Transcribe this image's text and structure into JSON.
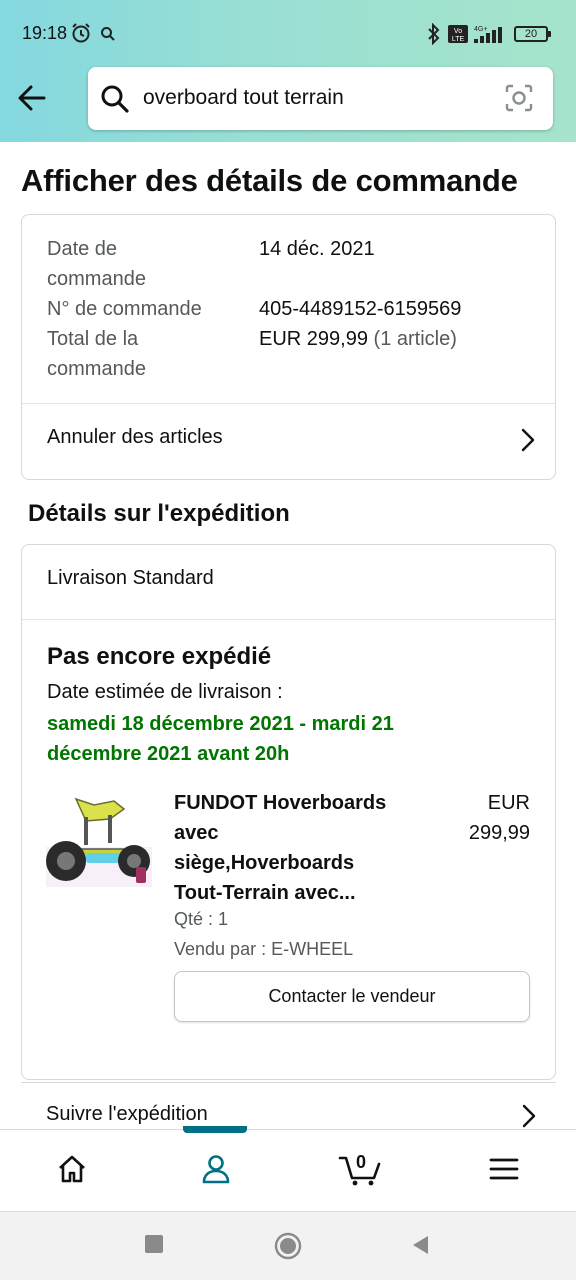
{
  "status_bar": {
    "time": "19:18",
    "battery": "20",
    "icons": [
      "alarm-icon",
      "search-small-icon",
      "bluetooth-icon",
      "volte-icon",
      "4g-signal-icon"
    ]
  },
  "search": {
    "value": "overboard tout terrain",
    "icons": [
      "back-arrow-icon",
      "search-icon",
      "camera-scan-icon"
    ]
  },
  "page": {
    "title": "Afficher des détails de commande"
  },
  "order_summary": {
    "date_label_line1": "Date de",
    "date_label_line2": "commande",
    "date_value": "14 déc. 2021",
    "number_label": "N° de commande",
    "number_value": "405-4489152-6159569",
    "total_label_line1": "Total de la",
    "total_label_line2": "commande",
    "total_value": "EUR 299,99",
    "total_count": "(1 article)",
    "cancel_label": "Annuler des articles"
  },
  "shipping": {
    "section_title": "Détails sur l'expédition",
    "method": "Livraison Standard",
    "status": "Pas encore expédié",
    "estimate_label": "Date estimée de livraison :",
    "estimate_date": "samedi 18 décembre 2021 - mardi 21 décembre 2021 avant 20h",
    "item": {
      "name_line1": "FUNDOT Hoverboards",
      "name_line2": "avec",
      "name_line3": "siège,Hoverboards",
      "name_line4": "Tout-Terrain avec...",
      "price_currency": "EUR",
      "price_value": "299,99",
      "quantity": "Qté : 1",
      "seller": "Vendu par : E-WHEEL",
      "contact_label": "Contacter le vendeur"
    },
    "track_label": "Suivre l'expédition"
  },
  "bottom_nav": {
    "items": [
      "home-icon",
      "account-icon",
      "cart-icon",
      "menu-icon"
    ],
    "active": "account-icon",
    "cart_count": "0"
  },
  "colors": {
    "accent": "#007185",
    "delivery_green": "#007600",
    "header_gradient_start": "#84d8e0",
    "header_gradient_end": "#a6e4cb"
  }
}
